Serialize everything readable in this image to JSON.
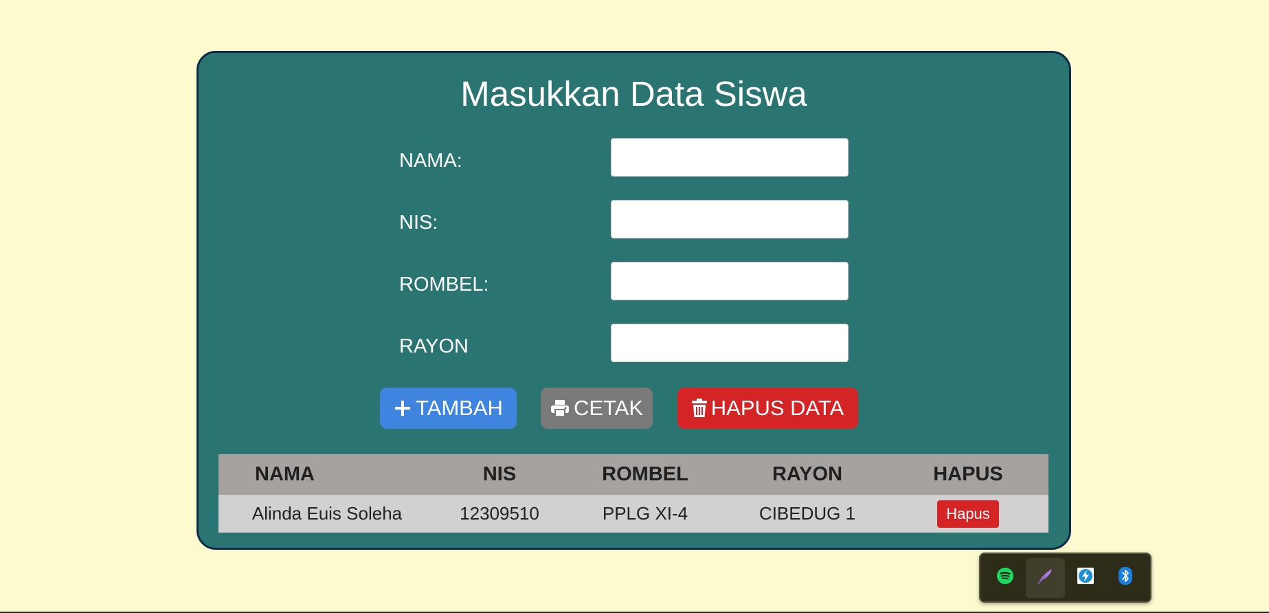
{
  "page": {
    "title": "Masukkan Data Siswa"
  },
  "form": {
    "fields": [
      {
        "label": "NAMA:",
        "value": ""
      },
      {
        "label": "NIS:",
        "value": ""
      },
      {
        "label": "ROMBEL:",
        "value": ""
      },
      {
        "label": "RAYON",
        "value": ""
      }
    ]
  },
  "buttons": {
    "add": {
      "label": "TAMBAH",
      "icon": "plus-icon",
      "color": "#3f85df"
    },
    "print": {
      "label": "CETAK",
      "icon": "printer-icon",
      "color": "#7a7a7a"
    },
    "delete_all": {
      "label": "HAPUS DATA",
      "icon": "trash-icon",
      "color": "#d42425"
    }
  },
  "table": {
    "headers": [
      "NAMA",
      "NIS",
      "ROMBEL",
      "RAYON",
      "HAPUS"
    ],
    "rows": [
      {
        "nama": "Alinda Euis Soleha",
        "nis": "12309510",
        "rombel": "PPLG XI-4",
        "rayon": "CIBEDUG 1",
        "action_label": "Hapus"
      }
    ]
  },
  "tray": {
    "icons": [
      "spotify-icon",
      "feather-pen-icon",
      "lightning-app-icon",
      "bluetooth-icon"
    ]
  },
  "colors": {
    "background": "#fdfacf",
    "card": "#2a7572",
    "card_border": "#0e2a44",
    "table_header": "#a6a2a0",
    "table_row": "#d2d0d0"
  }
}
